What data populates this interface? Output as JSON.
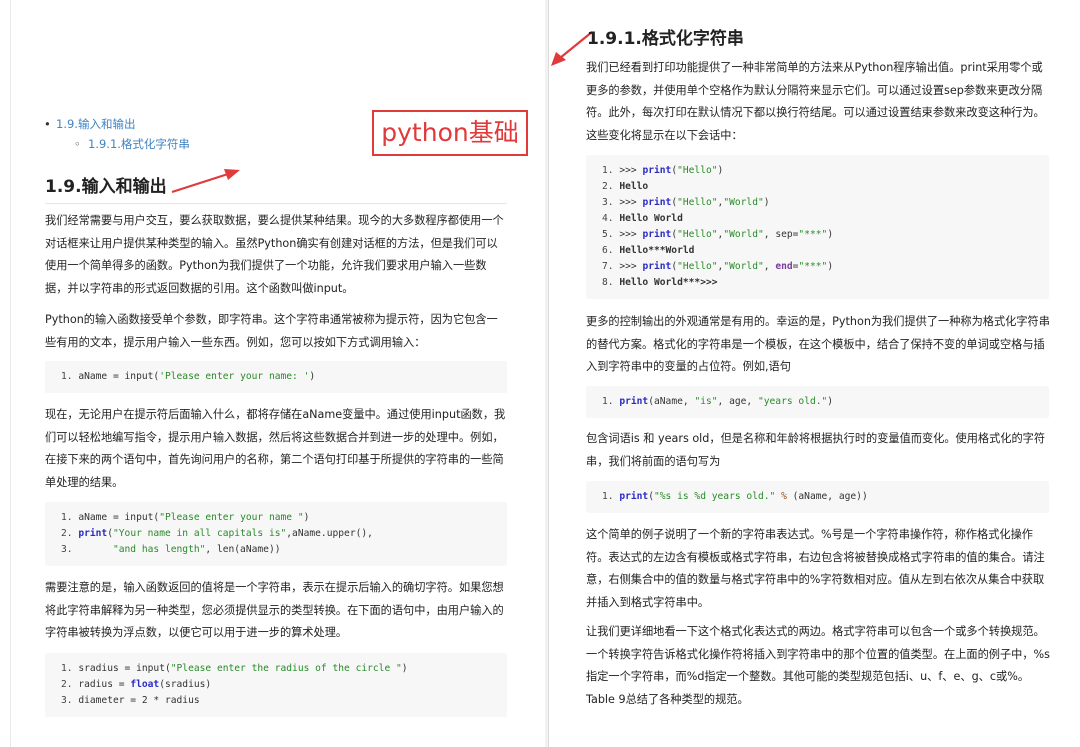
{
  "toc": {
    "item1": "1.9.输入和输出",
    "item2": "1.9.1.格式化字符串"
  },
  "stamp": "python基础",
  "left": {
    "heading": "1.9.输入和输出",
    "p1": "我们经常需要与用户交互，要么获取数据，要么提供某种结果。现今的大多数程序都使用一个对话框来让用户提供某种类型的输入。虽然Python确实有创建对话框的方法，但是我们可以使用一个简单得多的函数。Python为我们提供了一个功能，允许我们要求用户输入一些数据，并以字符串的形式返回数据的引用。这个函数叫做input。",
    "p2": "Python的输入函数接受单个参数，即字符串。这个字符串通常被称为提示符，因为它包含一些有用的文本，提示用户输入一些东西。例如，您可以按如下方式调用输入：",
    "p3": "现在，无论用户在提示符后面输入什么，都将存储在aName变量中。通过使用input函数，我们可以轻松地编写指令，提示用户输入数据，然后将这些数据合并到进一步的处理中。例如，在接下来的两个语句中，首先询问用户的名称，第二个语句打印基于所提供的字符串的一些简单处理的结果。",
    "p4": "需要注意的是，输入函数返回的值将是一个字符串，表示在提示后输入的确切字符。如果您想将此字符串解释为另一种类型，您必须提供显示的类型转换。在下面的语句中，由用户输入的字符串被转换为浮点数，以便它可以用于进一步的算术处理。"
  },
  "right": {
    "heading": "1.9.1.格式化字符串",
    "p1": "我们已经看到打印功能提供了一种非常简单的方法来从Python程序输出值。print采用零个或更多的参数，并使用单个空格作为默认分隔符来显示它们。可以通过设置sep参数来更改分隔符。此外，每次打印在默认情况下都以换行符结尾。可以通过设置结束参数来改变这种行为。这些变化将显示在以下会话中：",
    "p2": "更多的控制输出的外观通常是有用的。幸运的是，Python为我们提供了一种称为格式化字符串的替代方案。格式化的字符串是一个模板，在这个模板中，结合了保持不变的单词或空格与插入到字符串中的变量的占位符。例如,语句",
    "p3": "包含词语is 和 years old，但是名称和年龄将根据执行时的变量值而变化。使用格式化的字符串，我们将前面的语句写为",
    "p4": "这个简单的例子说明了一个新的字符串表达式。%号是一个字符串操作符，称作格式化操作符。表达式的左边含有模板或格式字符串，右边包含将被替换成格式字符串的值的集合。请注意，右侧集合中的值的数量与格式字符串中的%字符数相对应。值从左到右依次从集合中获取并插入到格式字符串中。",
    "p5": "让我们更详细地看一下这个格式化表达式的两边。格式字符串可以包含一个或多个转换规范。一个转换字符告诉格式化操作符将插入到字符串中的那个位置的值类型。在上面的例子中，%s指定一个字符串，而%d指定一个整数。其他可能的类型规范包括i、u、f、e、g、c或%。Table 9总结了各种类型的规范。"
  },
  "colors": {
    "link": "#4183c4",
    "stamp": "#e03a3a",
    "arrow": "#e03a3a",
    "code_bg": "#f7f7f7"
  }
}
